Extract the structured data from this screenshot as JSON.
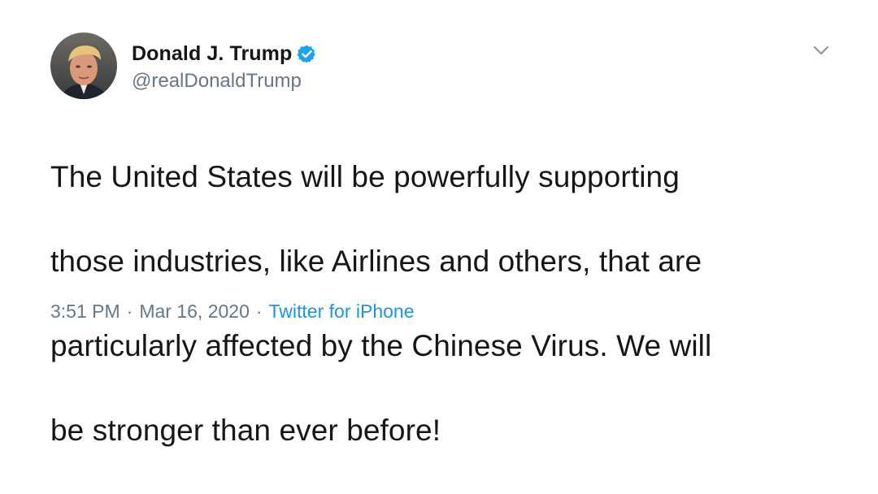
{
  "tweet": {
    "author": {
      "display_name": "Donald J. Trump",
      "handle": "@realDonaldTrump",
      "verified": true
    },
    "text_lines": [
      "The United States will be powerfully supporting",
      "those industries, like Airlines and others, that are",
      "particularly affected by the Chinese Virus. We will",
      "be stronger than ever before!"
    ],
    "time": "3:51 PM",
    "separator": "·",
    "date": "Mar 16, 2020",
    "source": "Twitter for iPhone"
  },
  "icons": {
    "verified": "verified-badge-icon",
    "menu": "chevron-down-icon"
  },
  "colors": {
    "text": "#14171a",
    "secondary": "#657786",
    "accent": "#1b95e0",
    "verified": "#1da1f2"
  }
}
